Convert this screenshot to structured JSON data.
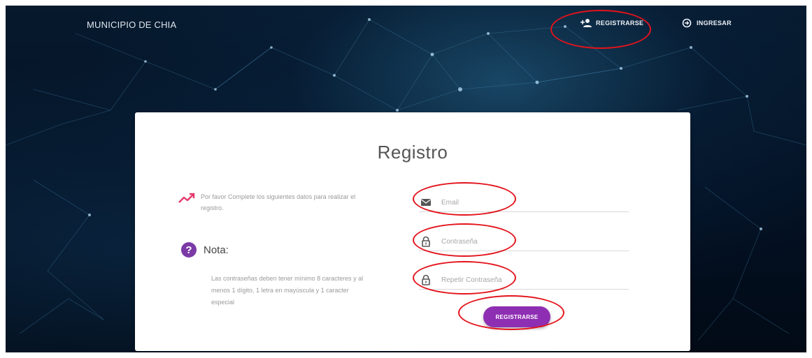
{
  "header": {
    "brand": "MUNICIPIO DE CHIA",
    "nav": {
      "register_label": "REGISTRARSE",
      "login_label": "INGRESAR"
    }
  },
  "card": {
    "title": "Registro",
    "info": "Por favor Complete los siguientes datos para realizar el registro.",
    "nota_label": "Nota:",
    "nota_text": "Las contraseñas deben tener mínimo 8 caracteres y al menos 1 dígito, 1 letra en mayúscula y 1 caracter especial",
    "fields": {
      "email_placeholder": "Email",
      "password_placeholder": "Contraseña",
      "repeat_password_placeholder": "Repetir Contraseña"
    },
    "submit_label": "REGISTRARSE"
  },
  "colors": {
    "accent": "#8e2fb3",
    "annotation": "#e3131b",
    "trend_icon": "#e3386a"
  },
  "icons": {
    "register": "person-add-icon",
    "login": "login-icon",
    "info": "trending-up-icon",
    "nota": "help-circle-icon",
    "email": "envelope-icon",
    "password": "lock-icon",
    "repeat_password": "lock-icon"
  }
}
